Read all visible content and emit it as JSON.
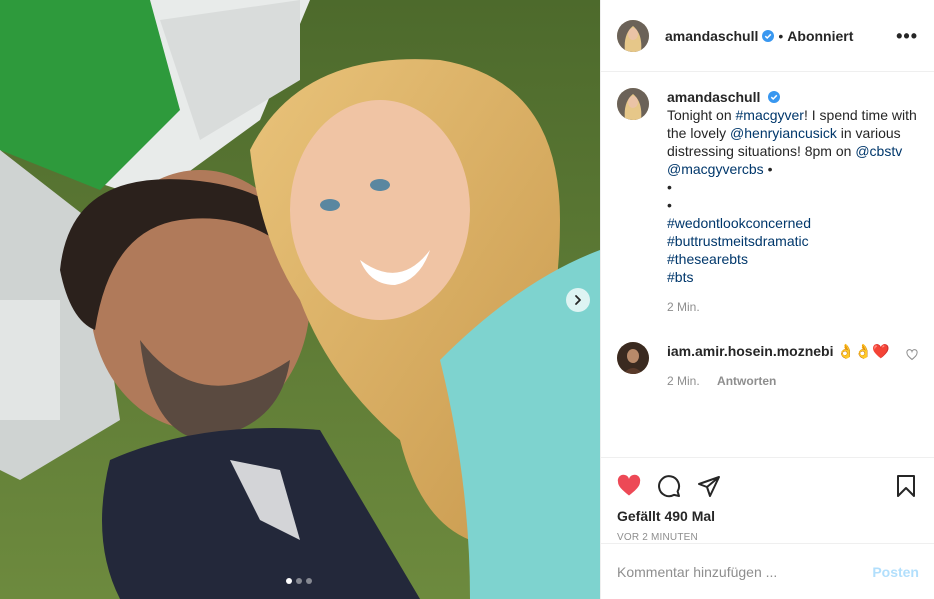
{
  "header": {
    "username": "amandaschull",
    "separator": "•",
    "follow_state": "Abonniert",
    "more_label": "•••"
  },
  "caption": {
    "username": "amandaschull",
    "text_1": "Tonight on ",
    "tag_macgyver": "#macgyver",
    "text_2": "! I spend time with the lovely ",
    "mention_henry": "@henryiancusick",
    "text_3": " in various distressing situations! 8pm on ",
    "mention_cbstv": "@cbstv",
    "text_4": " ",
    "mention_macgyvercbs": "@macgyvercbs",
    "text_5": " •",
    "bullet_1": "•",
    "bullet_2": "•",
    "tag_1": "#wedontlookconcerned",
    "tag_2": "#buttrustmeitsdramatic",
    "tag_3": "#thesearebts",
    "tag_4": "#bts",
    "time": "2 Min."
  },
  "comments": [
    {
      "username": "iam.amir.hosein.moznebi",
      "text": "👌👌❤️",
      "time": "2 Min.",
      "reply_label": "Antworten"
    }
  ],
  "actions": {
    "likes": "Gefällt 490 Mal",
    "timestamp": "VOR 2 MINUTEN",
    "liked": true,
    "like_color": "#ed4956"
  },
  "add_comment": {
    "placeholder": "Kommentar hinzufügen ...",
    "post_label": "Posten"
  },
  "carousel": {
    "count": 3,
    "active_index": 0
  },
  "colors": {
    "link": "#00376b",
    "verified": "#3897f0",
    "muted": "#8e8e8e",
    "post_disabled": "#b2dffc"
  }
}
